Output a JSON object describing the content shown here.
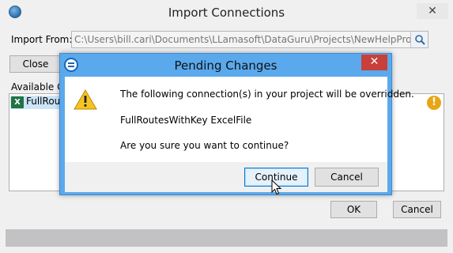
{
  "main_window": {
    "title": "Import Connections",
    "close_glyph": "✕",
    "import_from_label": "Import From:",
    "import_from_value": "C:\\Users\\bill.cari\\Documents\\LLamasoft\\DataGuru\\Projects\\NewHelpProject\\Inpu",
    "close_button": "Close",
    "available_label": "Available Co",
    "list_items": [
      {
        "label": "FullRou",
        "icon": "excel-icon"
      }
    ],
    "warning_badge": "!",
    "ok_button": "OK",
    "cancel_button": "Cancel"
  },
  "dialog": {
    "title": "Pending Changes",
    "close_glyph": "✕",
    "line1": "The following connection(s) in your project will be overridden.",
    "line2": "FullRoutesWithKey ExcelFile",
    "line3": "Are you sure you want to continue?",
    "continue_button": "Continue",
    "cancel_button": "Cancel"
  },
  "icons": {
    "app": "globe-icon",
    "browse": "search-icon",
    "dialog": "info-icon",
    "warning": "warning-triangle-icon",
    "cursor": "mouse-pointer-icon"
  },
  "colors": {
    "dialog_frame": "#5aa9ec",
    "dialog_close": "#c9403a",
    "excel": "#217346",
    "warning": "#e7a614"
  }
}
